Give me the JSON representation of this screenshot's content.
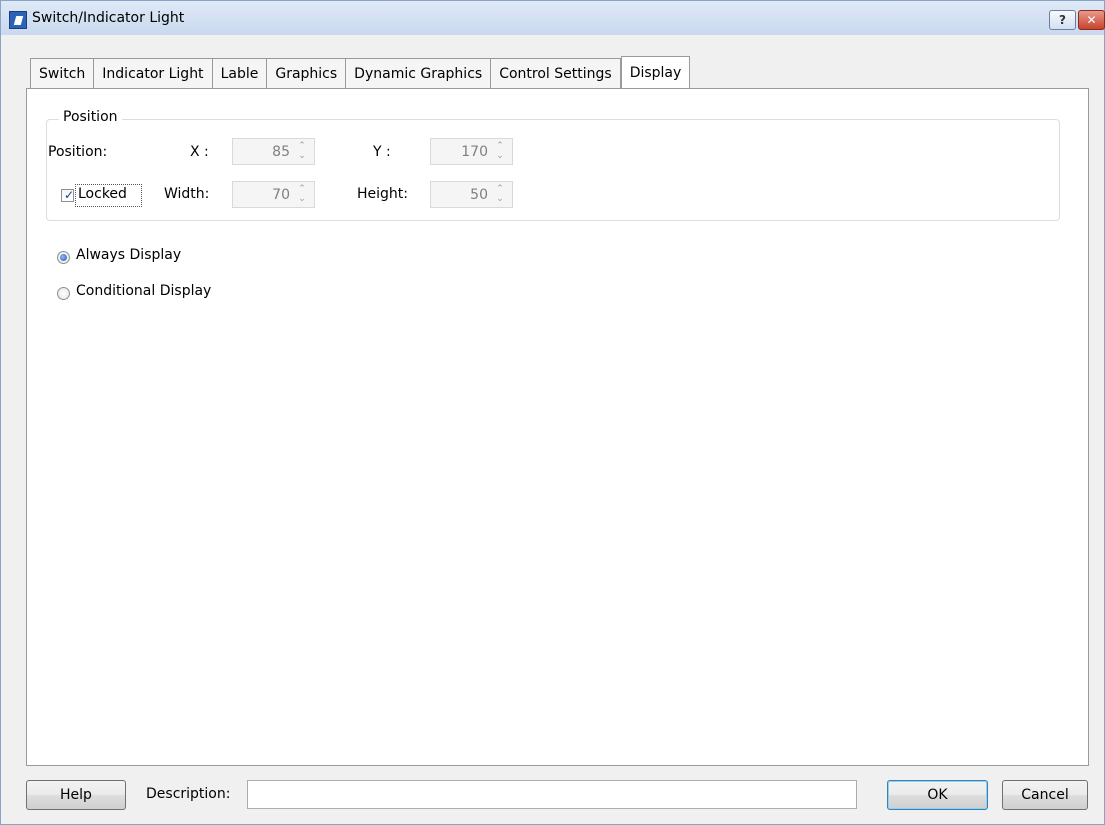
{
  "window": {
    "title": "Switch/Indicator Light",
    "help_button": "?",
    "close_button": "✕"
  },
  "tabs": [
    {
      "label": "Switch"
    },
    {
      "label": "Indicator Light"
    },
    {
      "label": "Lable"
    },
    {
      "label": "Graphics"
    },
    {
      "label": "Dynamic Graphics"
    },
    {
      "label": "Control Settings"
    },
    {
      "label": "Display",
      "active": true
    }
  ],
  "position_group": {
    "title": "Position",
    "position_label": "Position:",
    "x_label": "X :",
    "x_value": "85",
    "y_label": "Y :",
    "y_value": "170",
    "locked_label": "Locked",
    "locked_checked": true,
    "width_label": "Width:",
    "width_value": "70",
    "height_label": "Height:",
    "height_value": "50"
  },
  "display_options": [
    {
      "label": "Always Display",
      "selected": true
    },
    {
      "label": "Conditional Display",
      "selected": false
    }
  ],
  "footer": {
    "help_button": "Help",
    "description_label": "Description:",
    "description_value": "",
    "ok_button": "OK",
    "cancel_button": "Cancel"
  }
}
